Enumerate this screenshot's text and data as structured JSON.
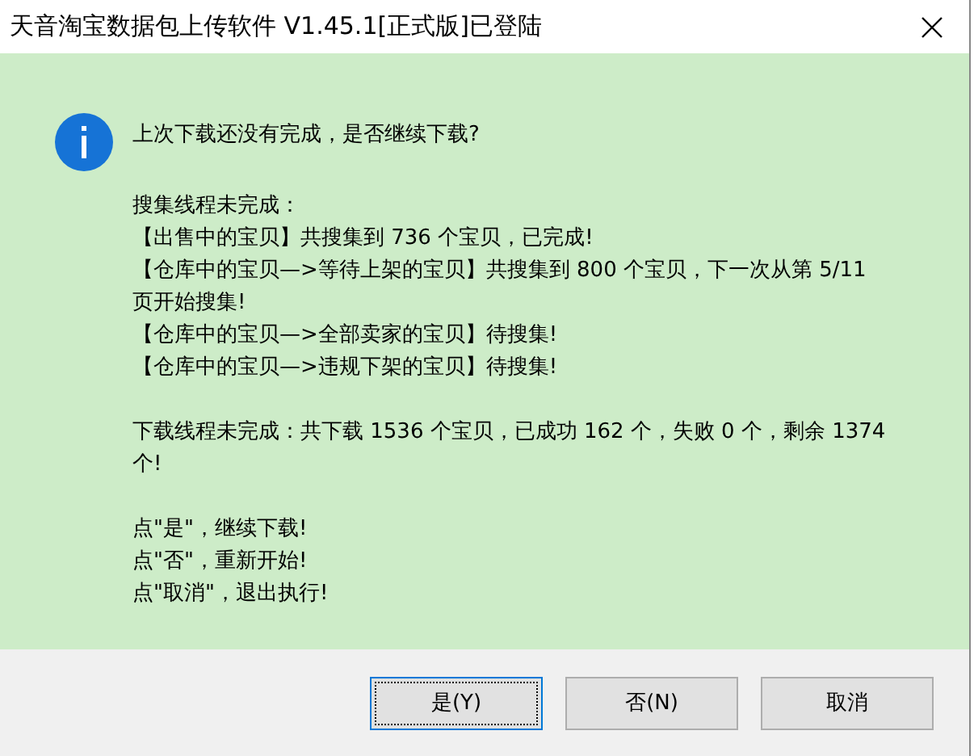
{
  "window": {
    "title": "天音淘宝数据包上传软件 V1.45.1[正式版]已登陆"
  },
  "message": {
    "headline": "上次下载还没有完成，是否继续下载?",
    "paragraphs": [
      [
        "搜集线程未完成：",
        "【出售中的宝贝】共搜集到 736 个宝贝，已完成!",
        "【仓库中的宝贝—>等待上架的宝贝】共搜集到 800 个宝贝，下一次从第 5/11",
        "页开始搜集!",
        "【仓库中的宝贝—>全部卖家的宝贝】待搜集!",
        "【仓库中的宝贝—>违规下架的宝贝】待搜集!"
      ],
      [
        "下载线程未完成：共下载 1536 个宝贝，已成功 162 个，失败 0 个，剩余 1374",
        "个!"
      ],
      [
        "点\"是\"，继续下载!",
        "点\"否\"，重新开始!",
        "点\"取消\"，退出执行!"
      ]
    ]
  },
  "buttons": [
    {
      "label": "是(Y)",
      "focused": true
    },
    {
      "label": "否(N)",
      "focused": false
    },
    {
      "label": "取消",
      "focused": false
    }
  ]
}
